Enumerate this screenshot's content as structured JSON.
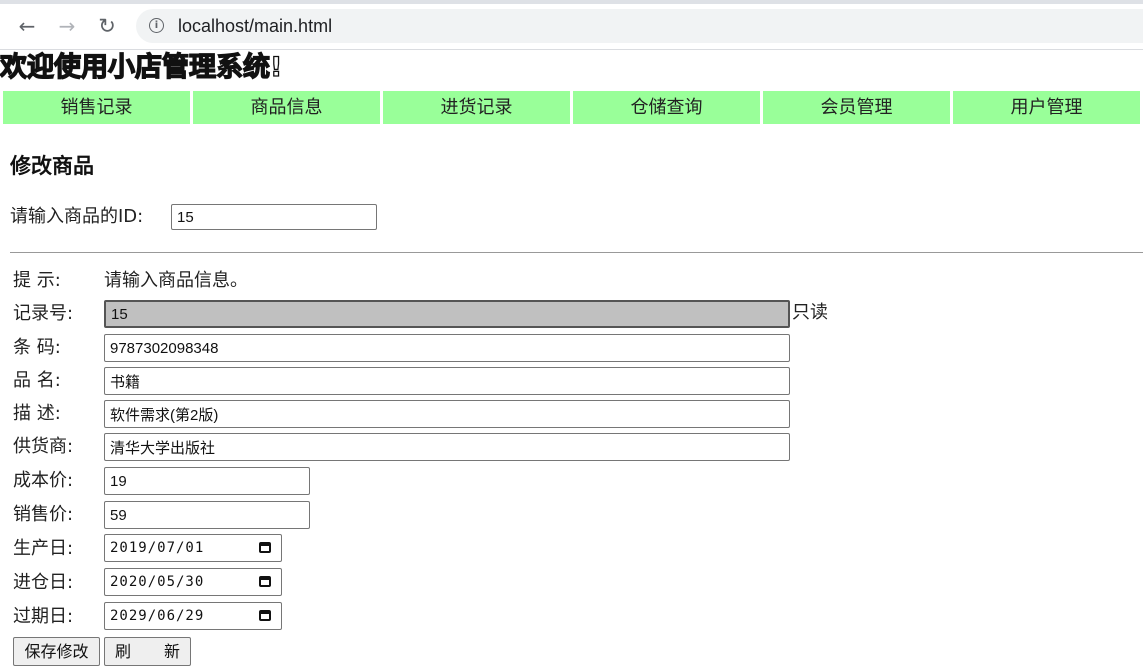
{
  "browser": {
    "url": "localhost/main.html",
    "back_icon": "←",
    "forward_icon": "→",
    "reload_icon": "↻",
    "info_icon": "i"
  },
  "site": {
    "title": "欢迎使用小店管理系统!"
  },
  "menu": [
    {
      "label": "销售记录"
    },
    {
      "label": "商品信息"
    },
    {
      "label": "进货记录"
    },
    {
      "label": "仓储查询"
    },
    {
      "label": "会员管理"
    },
    {
      "label": "用户管理"
    }
  ],
  "menu_color": "#99ff99",
  "page": {
    "heading": "修改商品",
    "id_label": "请输入商品的ID:",
    "id_value": "15"
  },
  "form": {
    "tip_label": "提  示:",
    "tip_text": "请输入商品信息。",
    "record_no_label": "记录号:",
    "record_no_value": "15",
    "readonly_note": "只读",
    "barcode_label": "条  码:",
    "barcode_value": "9787302098348",
    "name_label": "品  名:",
    "name_value": "书籍",
    "desc_label": "描  述:",
    "desc_value": "软件需求(第2版)",
    "supplier_label": "供货商:",
    "supplier_value": "清华大学出版社",
    "cost_label": "成本价:",
    "cost_value": "19",
    "price_label": "销售价:",
    "price_value": "59",
    "produce_label": "生产日:",
    "produce_value": "2019/07/01",
    "stock_label": "进仓日:",
    "stock_value": "2020/05/30",
    "expire_label": "过期日:",
    "expire_value": "2029/06/29",
    "save_label": "保存修改",
    "refresh_label": "刷 新"
  }
}
